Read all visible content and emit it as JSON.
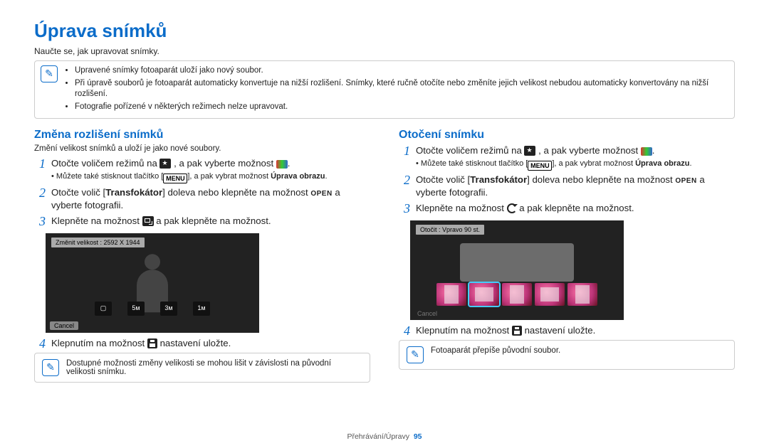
{
  "title": "Úprava snímků",
  "subtitle": "Naučte se, jak upravovat snímky.",
  "top_notes": [
    "Upravené snímky fotoaparát uloží jako nový soubor.",
    "Při úpravě souborů je fotoaparát automaticky konvertuje na nižší rozlišení. Snímky, které ručně otočíte nebo změníte jejich velikost nebudou automaticky konvertovány na nižší rozlišení.",
    "Fotografie pořízené v některých režimech nelze upravovat."
  ],
  "left": {
    "heading": "Změna rozlišení snímků",
    "intro": "Změní velikost snímků a uloží je jako nové soubory.",
    "step1_a": "Otočte voličem režimů na ",
    "step1_b": " , a pak vyberte možnost ",
    "step1_sub_a": "Můžete také stisknout tlačítko [",
    "step1_sub_menu": "MENU",
    "step1_sub_b": "], a pak vybrat možnost ",
    "step1_sub_bold": "Úprava obrazu",
    "step2_a": "Otočte volič [",
    "step2_bold": "Transfokátor",
    "step2_b": "] doleva nebo klepněte na možnost ",
    "step2_open": "OPEN",
    "step2_c": " a vyberte fotografii.",
    "step3_a": "Klepněte na možnost ",
    "step3_b": " a pak klepněte na možnost.",
    "mock_chip": "Změnit velikost : 2592 X 1944",
    "mock_cancel": "Cancel",
    "mock_thumbs": [
      "▢",
      "5м",
      "3м",
      "1м"
    ],
    "step4_a": "Klepnutím na možnost ",
    "step4_b": " nastavení uložte.",
    "note": "Dostupné možnosti změny velikosti se mohou lišit v závislosti na původní velikosti snímku."
  },
  "right": {
    "heading": "Otočení snímku",
    "step1_a": "Otočte voličem režimů na ",
    "step1_b": " , a pak vyberte možnost ",
    "step1_sub_a": "Můžete také stisknout tlačítko [",
    "step1_sub_menu": "MENU",
    "step1_sub_b": "], a pak vybrat možnost ",
    "step1_sub_bold": "Úprava obrazu",
    "step2_a": "Otočte volič [",
    "step2_bold": "Transfokátor",
    "step2_b": "] doleva nebo klepněte na možnost ",
    "step2_open": "OPEN",
    "step2_c": " a vyberte fotografii.",
    "step3_a": "Klepněte na možnost ",
    "step3_b": " a pak klepněte na možnost.",
    "mock_chip": "Otočit : Vpravo 90 st.",
    "mock_cancel": "Cancel",
    "step4_a": "Klepnutím na možnost ",
    "step4_b": " nastavení uložte.",
    "note": "Fotoaparát přepíše původní soubor."
  },
  "footer": {
    "path": "Přehrávání/Úpravy",
    "page": "95"
  }
}
